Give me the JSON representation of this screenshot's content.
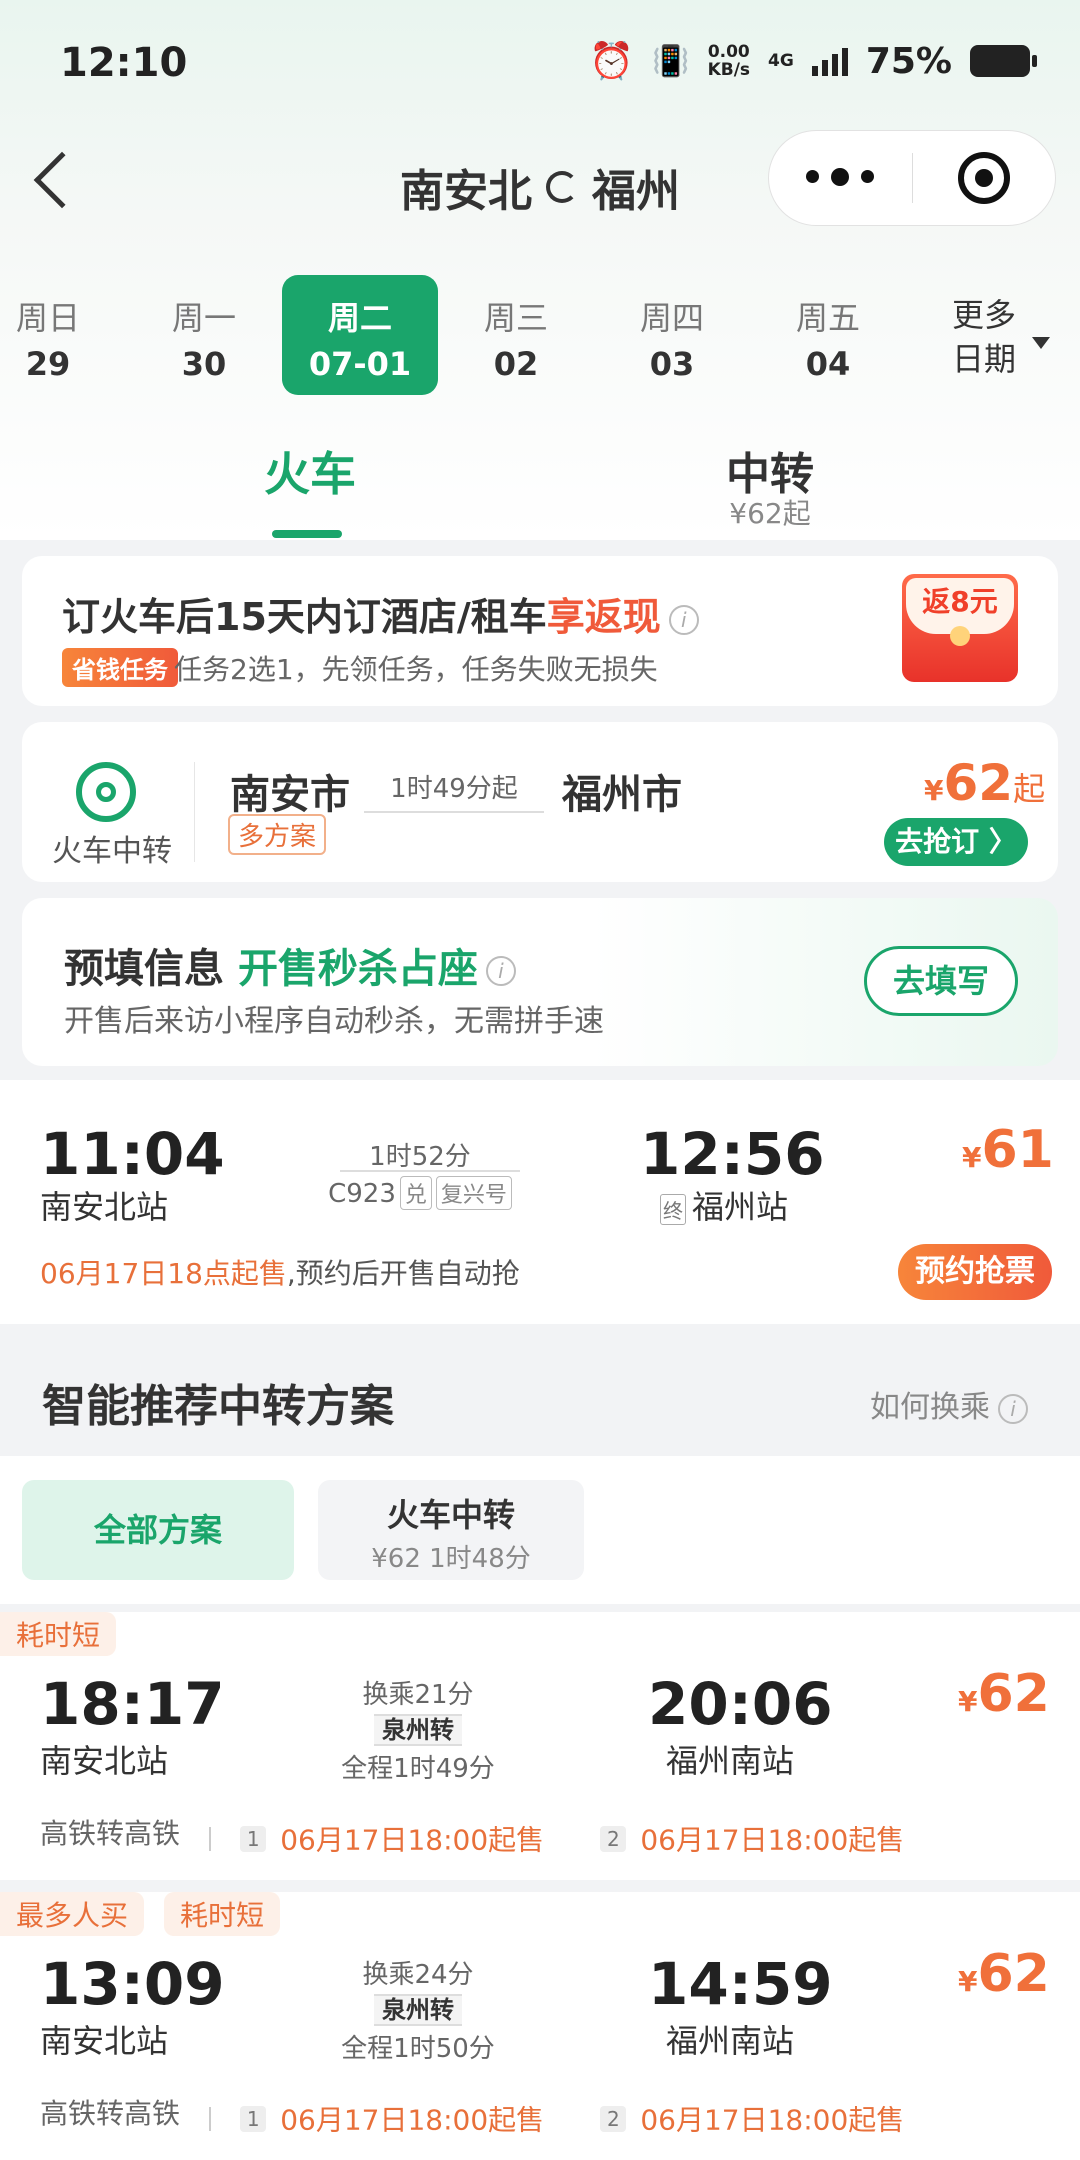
{
  "status_bar": {
    "time": "12:10",
    "net_speed_top": "0.00",
    "net_speed_unit": "KB/s",
    "network": "4G",
    "battery": "75%"
  },
  "header": {
    "from": "南安北",
    "to": "福州"
  },
  "dates": [
    {
      "weekday": "周日",
      "date": "29"
    },
    {
      "weekday": "周一",
      "date": "30"
    },
    {
      "weekday": "周二",
      "date": "07-01"
    },
    {
      "weekday": "周三",
      "date": "02"
    },
    {
      "weekday": "周四",
      "date": "03"
    },
    {
      "weekday": "周五",
      "date": "04"
    }
  ],
  "more_dates": {
    "line1": "更多",
    "line2": "日期"
  },
  "tabs": {
    "train": "火车",
    "transfer": "中转",
    "transfer_price": "¥62起"
  },
  "promo": {
    "title": "订火车后15天内订酒店/租车",
    "title_highlight": "享返现",
    "badge": "省钱任务",
    "subtitle": "任务2选1，先领任务，任务失败无损失",
    "redpack": "返8元"
  },
  "transfer_card": {
    "icon_label": "火车中转",
    "from": "南安市",
    "duration": "1时49分起",
    "to": "福州市",
    "tag": "多方案",
    "yen": "¥",
    "price": "62",
    "price_suffix": "起",
    "button": "去抢订 〉"
  },
  "prefill": {
    "title": "预填信息",
    "title_highlight": "开售秒杀占座",
    "subtitle": "开售后来访小程序自动秒杀，无需拼手速",
    "button": "去填写"
  },
  "train": {
    "depart_time": "11:04",
    "depart_station": "南安北站",
    "duration": "1时52分",
    "train_no": "C923",
    "tag1": "兑",
    "tag2": "复兴号",
    "arrive_time": "12:56",
    "end_tag": "终",
    "arrive_station": "福州站",
    "yen": "¥",
    "price": "61",
    "sale_time": "06月17日18点起售",
    "sale_note": ",预约后开售自动抢",
    "button": "预约抢票"
  },
  "section": {
    "title": "智能推荐中转方案",
    "help": "如何换乘"
  },
  "chips": {
    "all": "全部方案",
    "train_title": "火车中转",
    "train_sub": "¥62 1时48分"
  },
  "plans": [
    {
      "tags": [
        "耗时短"
      ],
      "depart_time": "18:17",
      "depart_station": "南安北站",
      "transfer_wait": "换乘21分",
      "via": "泉州转",
      "total": "全程1时49分",
      "arrive_time": "20:06",
      "arrive_station": "福州南站",
      "yen": "¥",
      "price": "62",
      "route_type": "高铁转高铁",
      "seg1_num": "1",
      "seg1_sale": "06月17日18:00起售",
      "seg2_num": "2",
      "seg2_sale": "06月17日18:00起售"
    },
    {
      "tags": [
        "最多人买",
        "耗时短"
      ],
      "depart_time": "13:09",
      "depart_station": "南安北站",
      "transfer_wait": "换乘24分",
      "via": "泉州转",
      "total": "全程1时50分",
      "arrive_time": "14:59",
      "arrive_station": "福州南站",
      "yen": "¥",
      "price": "62",
      "route_type": "高铁转高铁",
      "seg1_num": "1",
      "seg1_sale": "06月17日18:00起售",
      "seg2_num": "2",
      "seg2_sale": "06月17日18:00起售"
    }
  ]
}
